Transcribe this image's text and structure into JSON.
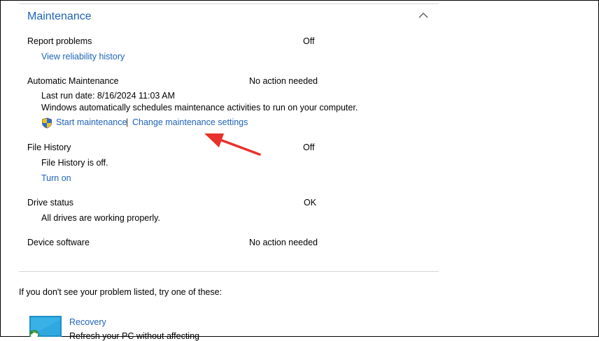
{
  "section": {
    "title": "Maintenance"
  },
  "report_problems": {
    "label": "Report problems",
    "status": "Off",
    "link": "View reliability history"
  },
  "automatic_maintenance": {
    "label": "Automatic Maintenance",
    "status": "No action needed",
    "last_run": "Last run date: 8/16/2024 11:03 AM",
    "description": "Windows automatically schedules maintenance activities to run on your computer.",
    "start_link": "Start maintenance",
    "separator": "|",
    "change_link": "Change maintenance settings"
  },
  "file_history": {
    "label": "File History",
    "status": "Off",
    "detail": "File History is off.",
    "link": "Turn on"
  },
  "drive_status": {
    "label": "Drive status",
    "status": "OK",
    "detail": "All drives are working properly."
  },
  "device_software": {
    "label": "Device software",
    "status": "No action needed"
  },
  "help": {
    "text": "If you don't see your problem listed, try one of these:"
  },
  "recovery": {
    "title": "Recovery",
    "description": "Refresh your PC without affecting"
  },
  "icons": {
    "collapse": "chevron-up-icon",
    "shield": "uac-shield-icon",
    "recovery": "recovery-icon",
    "annotation": "red-arrow"
  },
  "colors": {
    "link": "#1e63b8",
    "annotation": "#e8312a"
  }
}
